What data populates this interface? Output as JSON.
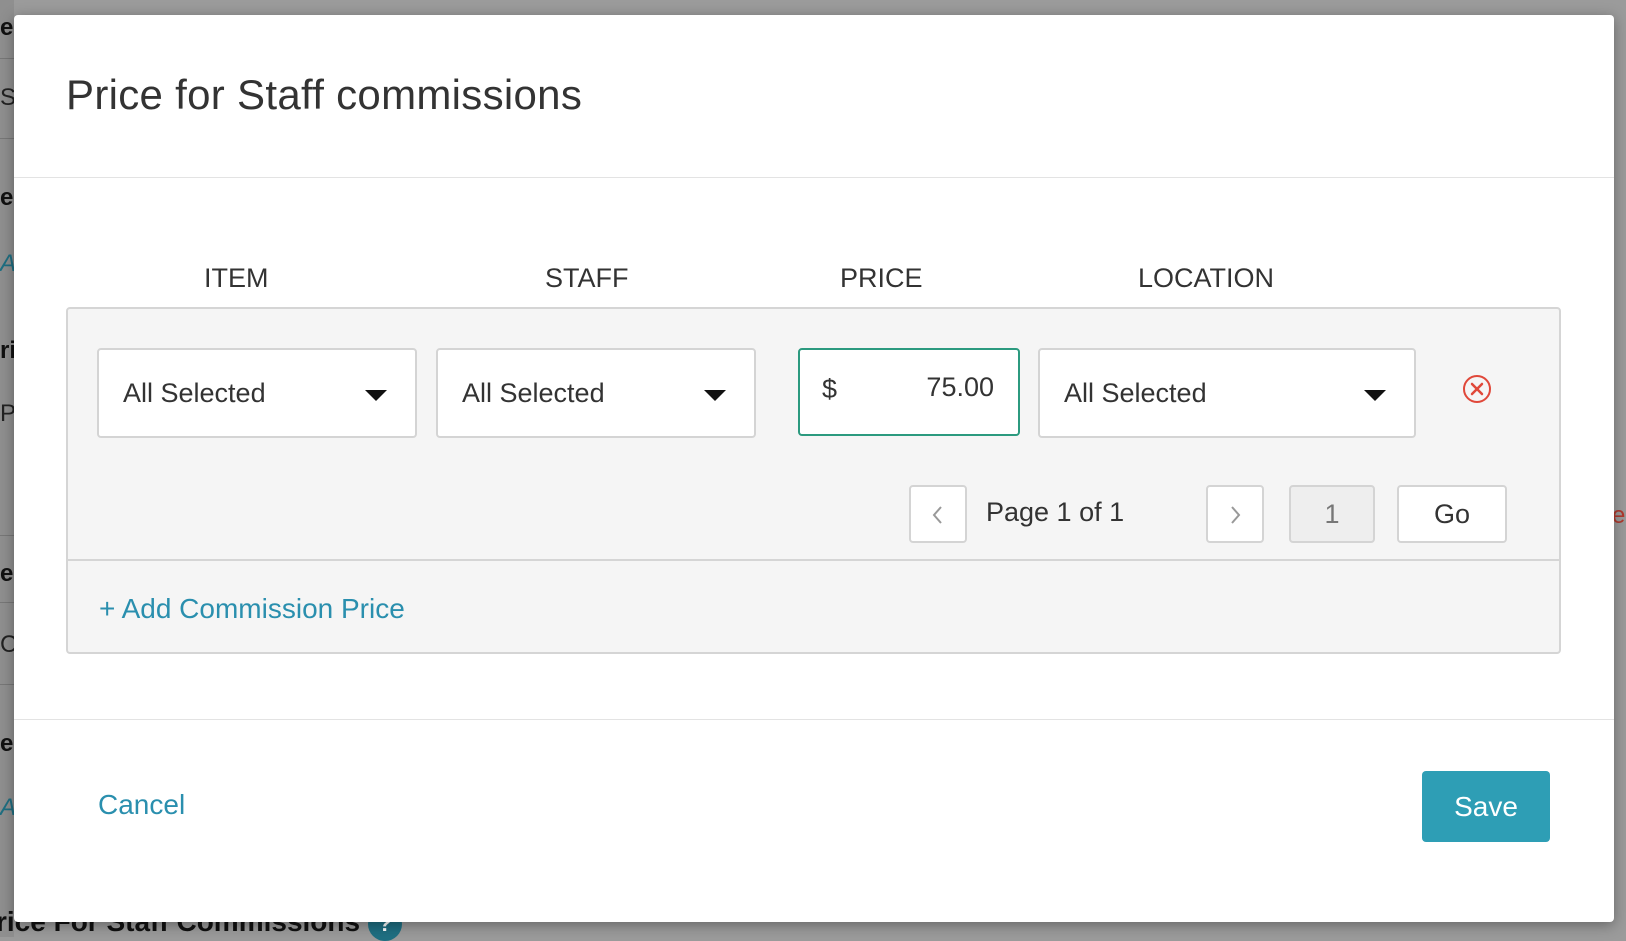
{
  "background": {
    "left_edge_chars": [
      "e",
      "S",
      "e",
      "A",
      "ri",
      "P",
      "e",
      "C",
      "e",
      "A"
    ],
    "right_edge_char": "e",
    "bottom_title": "rice For Staff Commissions",
    "help_icon": "?"
  },
  "modal": {
    "title": "Price for Staff commissions",
    "columns": {
      "item": "ITEM",
      "staff": "STAFF",
      "price": "PRICE",
      "location": "LOCATION"
    },
    "row": {
      "item_select": "All Selected",
      "staff_select": "All Selected",
      "currency_symbol": "$",
      "price_value": "75.00",
      "location_select": "All Selected",
      "remove_icon": "close-circle-icon"
    },
    "pagination": {
      "prev_icon": "chevron-left-icon",
      "page_text": "Page 1 of 1",
      "next_icon": "chevron-right-icon",
      "page_input_value": "1",
      "go_label": "Go"
    },
    "add_link": "+ Add Commission Price",
    "footer": {
      "cancel_label": "Cancel",
      "save_label": "Save"
    }
  },
  "colors": {
    "accent": "#2e9eb5",
    "link": "#2a8fae",
    "focus_border": "#2c9a7f",
    "remove": "#e0483a"
  }
}
